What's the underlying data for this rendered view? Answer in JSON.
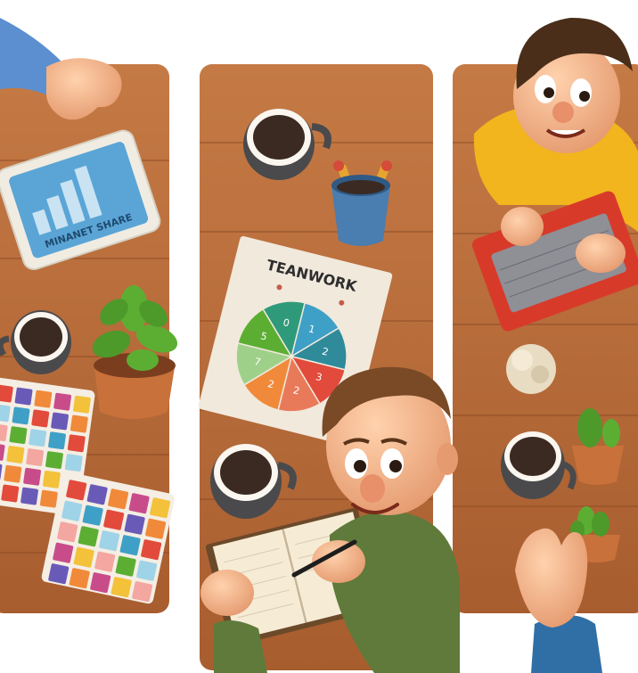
{
  "tablet_text": "MINANET SHARE",
  "poster_title": "TEANWORK",
  "wheel_numbers": [
    "1",
    "2",
    "3",
    "2",
    "2",
    "7",
    "5",
    "0"
  ],
  "palette": {
    "wood": "#b5683a",
    "wood_dark": "#8a4a24",
    "table_gap": "#ffffff",
    "sleeve_blue": "#5b8fd0",
    "shirt_yellow": "#f2b51d",
    "shirt_green": "#5f7a3a",
    "laptop_red": "#d83a2a",
    "coffee": "#3a2a22"
  }
}
